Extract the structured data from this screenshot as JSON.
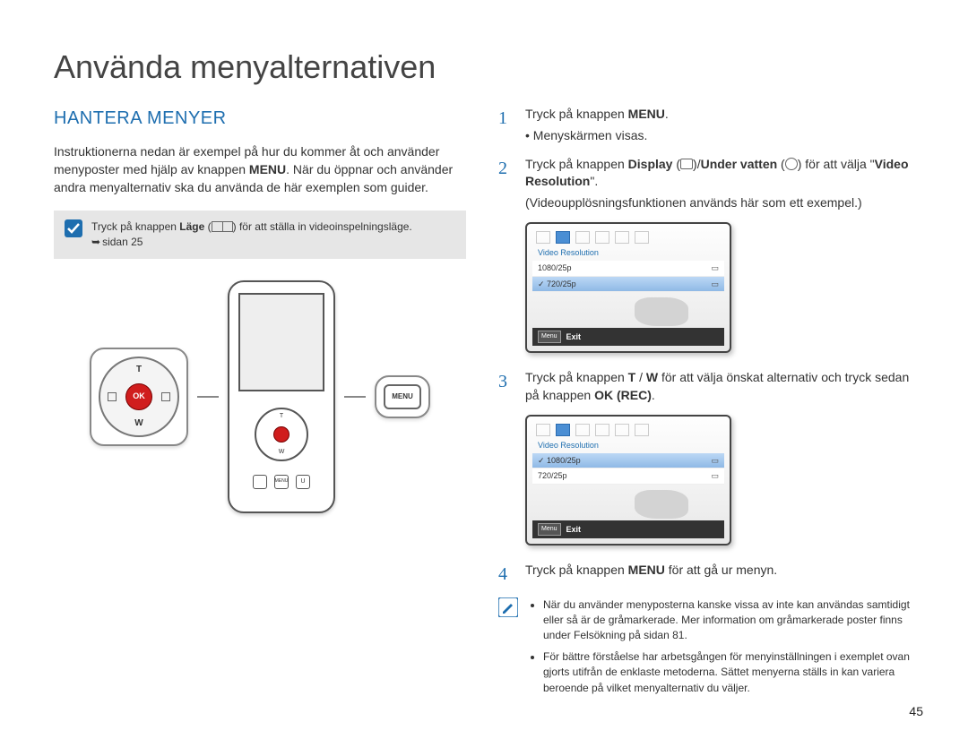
{
  "title": "Använda menyalternativen",
  "section": "HANTERA MENYER",
  "intro": "Instruktionerna nedan är exempel på hur du kommer åt och använder menyposter med hjälp av knappen <b>MENU</b>. När du öppnar och använder andra menyalternativ ska du använda de här exemplen som guider.",
  "note_mode": {
    "prefix": "Tryck på knappen ",
    "bold": "Läge",
    "suffix": " (",
    "suffix2": ") för att ställa in videoinspelningsläge.",
    "page_ref": "sidan 25"
  },
  "dpad": {
    "ok": "OK",
    "t": "T",
    "w": "W"
  },
  "menubtn": "MENU",
  "illustration_small": {
    "t": "T",
    "w": "W",
    "u": "U"
  },
  "steps": {
    "s1": {
      "num": "1",
      "text_pre": "Tryck på knappen ",
      "bold1": "MENU",
      "text_post": ".",
      "bullet": "Menyskärmen visas."
    },
    "s2": {
      "num": "2",
      "text_pre": "Tryck på knappen ",
      "bold1": "Display",
      "sep1": " (",
      "sep2": ")/",
      "bold2": "Under vatten",
      "sep3": " (",
      "sep4": ") för att välja \"",
      "bold3": "Video Resolution",
      "sep5": "\".",
      "note": "(Videoupplösningsfunktionen används här som ett exempel.)"
    },
    "s3": {
      "num": "3",
      "text_pre": "Tryck på knappen ",
      "bold1": "T",
      "sep1": " / ",
      "bold2": "W",
      "text_mid": " för att välja önskat alternativ och tryck sedan på knappen ",
      "bold3": "OK (REC)",
      "text_post": "."
    },
    "s4": {
      "num": "4",
      "text_pre": "Tryck på knappen ",
      "bold1": "MENU",
      "text_post": " för att gå ur menyn."
    }
  },
  "lcd": {
    "title": "Video Resolution",
    "rows": [
      "1080/25p",
      "720/25p"
    ],
    "selected_first_screen": 1,
    "selected_second_screen": 0,
    "footer_btn": "Menu",
    "footer_label": "Exit"
  },
  "final_notes": [
    "När du använder menyposterna kanske vissa av inte kan användas samtidigt eller så är de gråmarkerade. Mer information om gråmarkerade poster finns under Felsökning på sidan 81.",
    "För bättre förståelse har arbetsgången för menyinställningen i exemplet ovan gjorts utifrån de enklaste metoderna. Sättet menyerna ställs in kan variera beroende på vilket menyalternativ du väljer."
  ],
  "page_num": "45"
}
